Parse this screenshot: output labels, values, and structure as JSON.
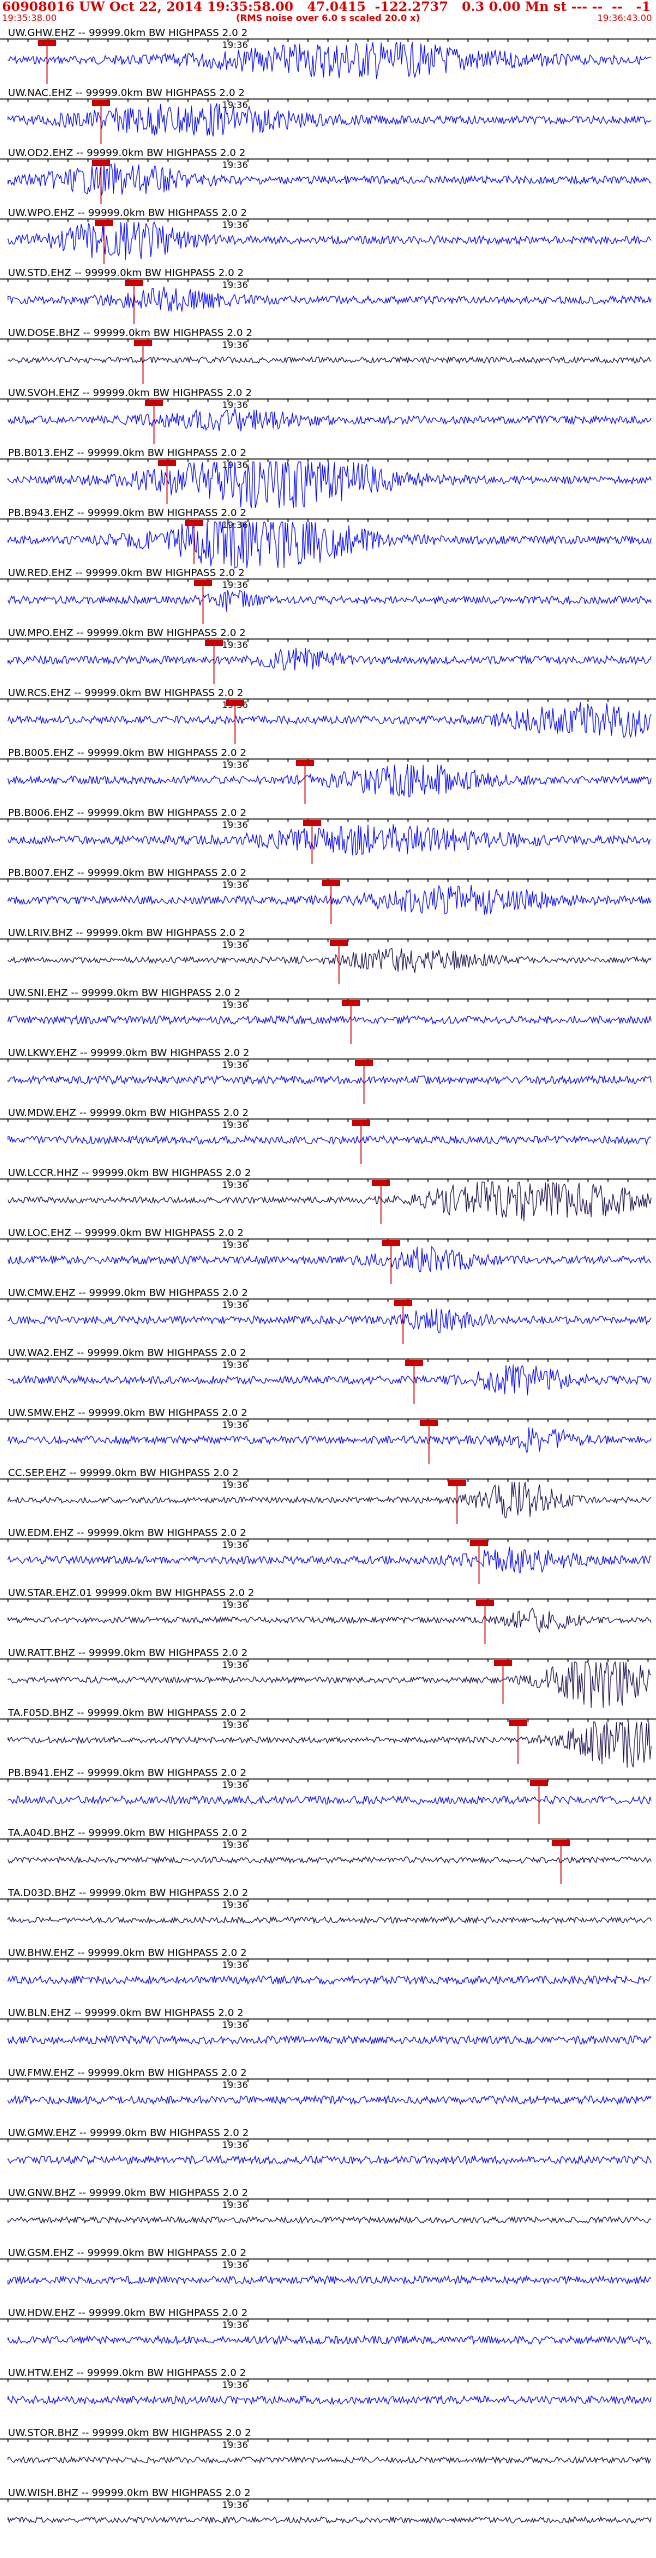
{
  "header": {
    "title": "60908016 UW Oct 22, 2014 19:35:58.00   47.0415  -122.2737   0.3 0.00 Mn st --- --  --   -1",
    "subtitle": "(RMS noise over 6.0 s scaled 20.0 x)",
    "start_time": "19:35:38.00",
    "end_time": "19:36:43.00"
  },
  "tick_label": "19:36",
  "colors": {
    "header": "#d40000",
    "pick": "#cc0000",
    "trace_blue": "#0000ff",
    "trace_dark": "#1a0a4a",
    "axis": "#000000"
  },
  "channels": [
    {
      "label": "UW.GHW.EHZ -- 99999.0km BW  HIGHPASS  2.0  2",
      "color": "blue"
    },
    {
      "label": "UW.NAC.EHZ -- 99999.0km BW  HIGHPASS  2.0  2",
      "color": "blue"
    },
    {
      "label": "UW.OD2.EHZ -- 99999.0km BW  HIGHPASS  2.0  2",
      "color": "blue"
    },
    {
      "label": "UW.WPO.EHZ -- 99999.0km BW  HIGHPASS  2.0  2",
      "color": "blue"
    },
    {
      "label": "UW.STD.EHZ -- 99999.0km BW  HIGHPASS  2.0  2",
      "color": "blue"
    },
    {
      "label": "UW.DOSE.BHZ -- 99999.0km BW  HIGHPASS  2.0  2",
      "color": "dark"
    },
    {
      "label": "UW.SVOH.EHZ -- 99999.0km BW  HIGHPASS  2.0  2",
      "color": "blue"
    },
    {
      "label": "PB.B013.EHZ -- 99999.0km BW  HIGHPASS  2.0  2",
      "color": "blue"
    },
    {
      "label": "PB.B943.EHZ -- 99999.0km BW  HIGHPASS  2.0  2",
      "color": "blue"
    },
    {
      "label": "UW.RED.EHZ -- 99999.0km BW  HIGHPASS  2.0  2",
      "color": "blue"
    },
    {
      "label": "UW.MPO.EHZ -- 99999.0km BW  HIGHPASS  2.0  2",
      "color": "blue"
    },
    {
      "label": "UW.RCS.EHZ -- 99999.0km BW  HIGHPASS  2.0  2",
      "color": "blue"
    },
    {
      "label": "PB.B005.EHZ -- 99999.0km BW  HIGHPASS  2.0  2",
      "color": "blue"
    },
    {
      "label": "PB.B006.EHZ -- 99999.0km BW  HIGHPASS  2.0  2",
      "color": "blue"
    },
    {
      "label": "PB.B007.EHZ -- 99999.0km BW  HIGHPASS  2.0  2",
      "color": "blue"
    },
    {
      "label": "UW.LRIV.BHZ -- 99999.0km BW  HIGHPASS  2.0  2",
      "color": "dark"
    },
    {
      "label": "UW.SNI.EHZ -- 99999.0km BW  HIGHPASS  2.0  2",
      "color": "blue"
    },
    {
      "label": "UW.LKWY.EHZ -- 99999.0km BW  HIGHPASS  2.0  2",
      "color": "blue"
    },
    {
      "label": "UW.MDW.EHZ -- 99999.0km BW  HIGHPASS  2.0  2",
      "color": "blue"
    },
    {
      "label": "UW.LCCR.HHZ -- 99999.0km BW  HIGHPASS  2.0  2",
      "color": "dark"
    },
    {
      "label": "UW.LOC.EHZ -- 99999.0km BW  HIGHPASS  2.0  2",
      "color": "blue"
    },
    {
      "label": "UW.CMW.EHZ -- 99999.0km BW  HIGHPASS  2.0  2",
      "color": "blue"
    },
    {
      "label": "UW.WA2.EHZ -- 99999.0km BW  HIGHPASS  2.0  2",
      "color": "blue"
    },
    {
      "label": "UW.SMW.EHZ -- 99999.0km BW  HIGHPASS  2.0  2",
      "color": "blue"
    },
    {
      "label": "CC.SEP.EHZ -- 99999.0km BW  HIGHPASS  2.0  2",
      "color": "dark"
    },
    {
      "label": "UW.EDM.EHZ -- 99999.0km BW  HIGHPASS  2.0  2",
      "color": "blue"
    },
    {
      "label": "UW.STAR.EHZ.01 99999.0km BW  HIGHPASS  2.0  2",
      "color": "dark"
    },
    {
      "label": "UW.RATT.BHZ -- 99999.0km BW  HIGHPASS  2.0  2",
      "color": "dark"
    },
    {
      "label": "TA.F05D.BHZ -- 99999.0km BW  HIGHPASS  2.0  2",
      "color": "dark"
    },
    {
      "label": "PB.B941.EHZ -- 99999.0km BW  HIGHPASS  2.0  2",
      "color": "blue"
    },
    {
      "label": "TA.A04D.BHZ -- 99999.0km BW  HIGHPASS  2.0  2",
      "color": "dark"
    },
    {
      "label": "TA.D03D.BHZ -- 99999.0km BW  HIGHPASS  2.0  2",
      "color": "dark"
    },
    {
      "label": "UW.BHW.EHZ -- 99999.0km BW  HIGHPASS  2.0  2",
      "color": "blue"
    },
    {
      "label": "UW.BLN.EHZ -- 99999.0km BW  HIGHPASS  2.0  2",
      "color": "blue"
    },
    {
      "label": "UW.FMW.EHZ -- 99999.0km BW  HIGHPASS  2.0  2",
      "color": "blue"
    },
    {
      "label": "UW.GMW.EHZ -- 99999.0km BW  HIGHPASS  2.0  2",
      "color": "blue"
    },
    {
      "label": "UW.GNW.BHZ -- 99999.0km BW  HIGHPASS  2.0  2",
      "color": "dark"
    },
    {
      "label": "UW.GSM.EHZ -- 99999.0km BW  HIGHPASS  2.0  2",
      "color": "blue"
    },
    {
      "label": "UW.HDW.EHZ -- 99999.0km BW  HIGHPASS  2.0  2",
      "color": "blue"
    },
    {
      "label": "UW.HTW.EHZ -- 99999.0km BW  HIGHPASS  2.0  2",
      "color": "blue"
    },
    {
      "label": "UW.STOR.BHZ -- 99999.0km BW  HIGHPASS  2.0  2",
      "color": "dark"
    },
    {
      "label": "UW.WISH.BHZ -- 99999.0km BW  HIGHPASS  2.0  2",
      "color": "dark"
    }
  ]
}
